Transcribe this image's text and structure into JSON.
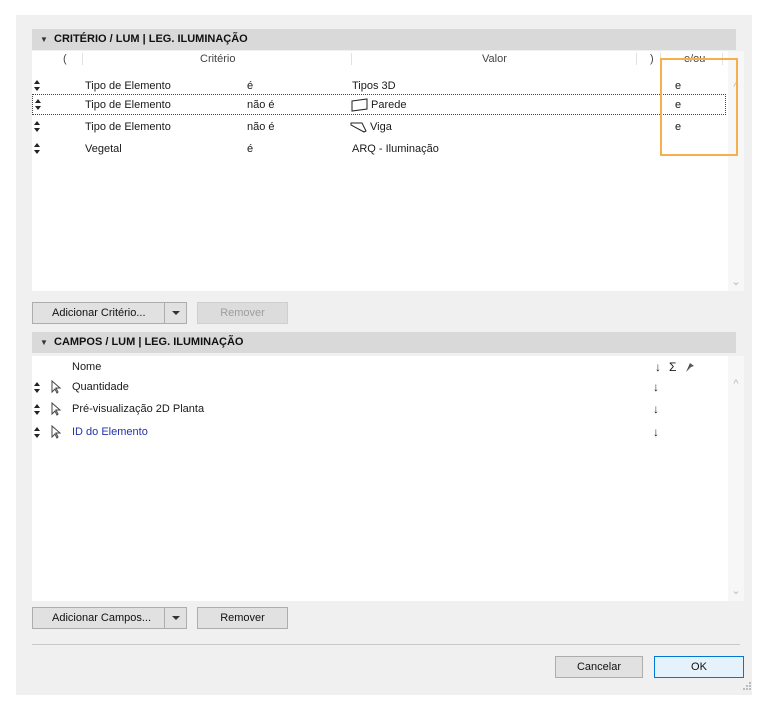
{
  "criteria_section": {
    "title": "CRITÉRIO / LUM | LEG. ILUMINAÇÃO",
    "columns": {
      "open_paren": "(",
      "criterio": "Critério",
      "valor": "Valor",
      "close_paren": ")",
      "eou": "e/ou"
    },
    "rows": [
      {
        "field": "Tipo de Elemento",
        "op": "é",
        "value": "Tipos 3D",
        "eou": "e",
        "value_icon": ""
      },
      {
        "field": "Tipo de Elemento",
        "op": "não é",
        "value": "Parede",
        "eou": "e",
        "value_icon": "wall-icon"
      },
      {
        "field": "Tipo de Elemento",
        "op": "não é",
        "value": "Viga",
        "eou": "e",
        "value_icon": "beam-icon"
      },
      {
        "field": "Vegetal",
        "op": "é",
        "value": "ARQ - Iluminação",
        "eou": "",
        "value_icon": ""
      }
    ],
    "add_button": "Adicionar Critério...",
    "remove_button": "Remover"
  },
  "fields_section": {
    "title": "CAMPOS / LUM | LEG. ILUMINAÇÃO",
    "columns": {
      "nome": "Nome",
      "sort": "↓",
      "sum": "Σ"
    },
    "rows": [
      {
        "name": "Quantidade",
        "sort": "↓"
      },
      {
        "name": "Pré-visualização 2D Planta",
        "sort": "↓"
      },
      {
        "name": "ID do Elemento",
        "sort": "↓"
      }
    ],
    "add_button": "Adicionar Campos...",
    "remove_button": "Remover"
  },
  "footer": {
    "cancel": "Cancelar",
    "ok": "OK"
  },
  "colors": {
    "accent": "#0078d7",
    "highlight": "#f5b04b",
    "link": "#2233aa"
  }
}
